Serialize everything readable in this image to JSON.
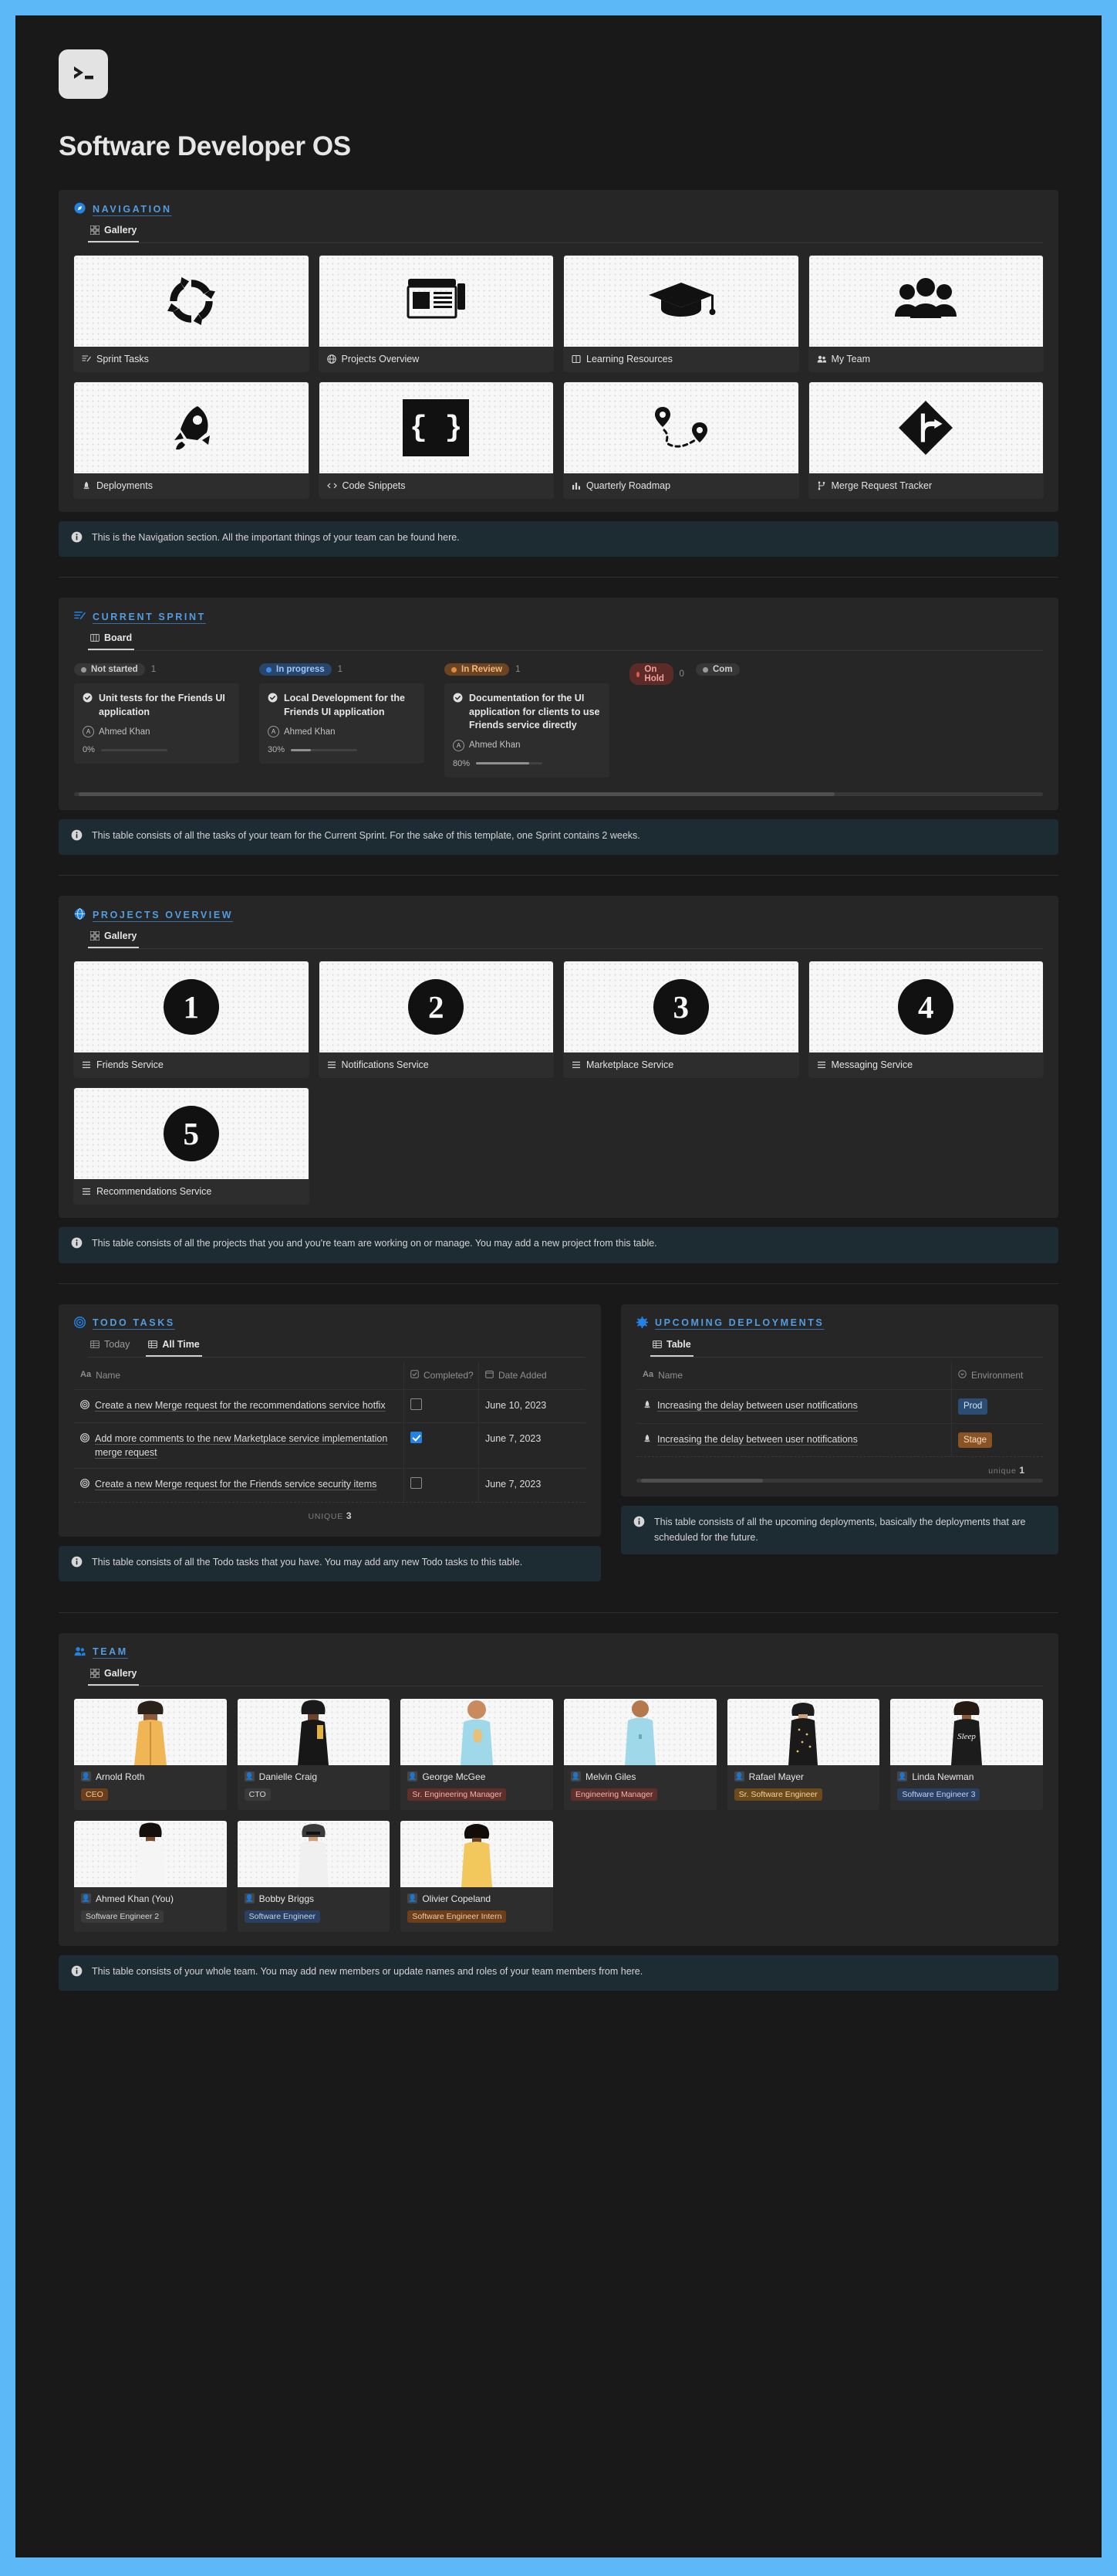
{
  "app": {
    "icon": "terminal-icon",
    "title": "Software Developer OS"
  },
  "navigation": {
    "section_label": "NAVIGATION",
    "section_icon": "compass-icon",
    "tabs": [
      {
        "label": "Gallery",
        "icon": "gallery-icon",
        "active": true
      }
    ],
    "cards": [
      {
        "label": "Sprint Tasks",
        "icon": "task-list-icon",
        "art": "refresh-cycle"
      },
      {
        "label": "Projects Overview",
        "icon": "globe-icon",
        "art": "browser-window"
      },
      {
        "label": "Learning Resources",
        "icon": "book-icon",
        "art": "graduation-cap"
      },
      {
        "label": "My Team",
        "icon": "people-icon",
        "art": "group-people"
      },
      {
        "label": "Deployments",
        "icon": "rocket-icon",
        "art": "rocket"
      },
      {
        "label": "Code Snippets",
        "icon": "code-icon",
        "art": "curly-braces"
      },
      {
        "label": "Quarterly Roadmap",
        "icon": "chart-icon",
        "art": "roadmap-pins"
      },
      {
        "label": "Merge Request Tracker",
        "icon": "branch-icon",
        "art": "merge-sign"
      }
    ],
    "callout": "This is the Navigation section. All the important things of your team can be found here.",
    "callout_icon": "info-icon"
  },
  "current_sprint": {
    "section_label": "CURRENT SPRINT",
    "section_icon": "task-list-icon",
    "tabs": [
      {
        "label": "Board",
        "icon": "board-icon",
        "active": true
      }
    ],
    "columns": [
      {
        "status": "Not started",
        "count": "1",
        "style": "p-grey",
        "cards": [
          {
            "title": "Unit tests for the Friends UI application",
            "assignee": "Ahmed Khan",
            "avatar": "A",
            "progress_label": "0%",
            "progress": 0
          }
        ]
      },
      {
        "status": "In progress",
        "count": "1",
        "style": "p-blue",
        "cards": [
          {
            "title": "Local Development for the Friends UI application",
            "assignee": "Ahmed Khan",
            "avatar": "A",
            "progress_label": "30%",
            "progress": 30
          }
        ]
      },
      {
        "status": "In Review",
        "count": "1",
        "style": "p-orng",
        "cards": [
          {
            "title": "Documentation for the UI application for clients to use Friends service directly",
            "assignee": "Ahmed Khan",
            "avatar": "A",
            "progress_label": "80%",
            "progress": 80
          }
        ]
      },
      {
        "status": "On Hold",
        "count": "0",
        "style": "p-red",
        "cards": []
      },
      {
        "status": "Com",
        "count": "",
        "style": "p-grey",
        "cards": []
      }
    ],
    "callout": "This table consists of all the tasks of your team for the Current Sprint. For the sake of this template, one Sprint contains 2 weeks.",
    "callout_icon": "info-icon"
  },
  "projects_overview": {
    "section_label": "PROJECTS OVERVIEW",
    "section_icon": "globe-icon",
    "tabs": [
      {
        "label": "Gallery",
        "icon": "gallery-icon",
        "active": true
      }
    ],
    "cards": [
      {
        "label": "Friends Service",
        "icon": "list-icon",
        "art": "1"
      },
      {
        "label": "Notifications Service",
        "icon": "list-icon",
        "art": "2"
      },
      {
        "label": "Marketplace Service",
        "icon": "list-icon",
        "art": "3"
      },
      {
        "label": "Messaging Service",
        "icon": "list-icon",
        "art": "4"
      },
      {
        "label": "Recommendations Service",
        "icon": "list-icon",
        "art": "5"
      }
    ],
    "callout": "This table consists of all the projects that you and you're team are working on or manage. You may add a new project from this table.",
    "callout_icon": "info-icon"
  },
  "todo_tasks": {
    "section_label": "TODO TASKS",
    "section_icon": "target-icon",
    "tabs": [
      {
        "label": "Today",
        "icon": "table-icon",
        "active": false
      },
      {
        "label": "All Time",
        "icon": "table-icon",
        "active": true
      }
    ],
    "headers": {
      "name": "Name",
      "completed": "Completed?",
      "date": "Date Added"
    },
    "header_icons": {
      "name": "text-icon",
      "completed": "checkbox-icon",
      "date": "calendar-icon"
    },
    "rows": [
      {
        "icon": "target-icon",
        "name": "Create a new Merge request for the recommendations service hotfix",
        "completed": false,
        "date": "June 10, 2023"
      },
      {
        "icon": "target-icon",
        "name": "Add more comments to the new Marketplace service implementation merge request",
        "completed": true,
        "date": "June 7, 2023"
      },
      {
        "icon": "target-icon",
        "name": "Create a new Merge request for the Friends service security items",
        "completed": false,
        "date": "June 7, 2023"
      }
    ],
    "unique_label": "UNIQUE",
    "unique_value": "3",
    "callout": "This table consists of all the Todo tasks that you have. You may add any new Todo tasks to this table.",
    "callout_icon": "info-icon"
  },
  "upcoming_deployments": {
    "section_label": "UPCOMING DEPLOYMENTS",
    "section_icon": "gear-icon",
    "tabs": [
      {
        "label": "Table",
        "icon": "table-icon",
        "active": true
      }
    ],
    "headers": {
      "name": "Name",
      "environment": "Environment"
    },
    "header_icons": {
      "name": "text-icon",
      "environment": "select-icon"
    },
    "rows": [
      {
        "icon": "rocket-icon",
        "name": "Increasing the delay between user notifications",
        "environment": "Prod",
        "env_style": "tag-prod"
      },
      {
        "icon": "rocket-icon",
        "name": "Increasing the delay between user notifications",
        "environment": "Stage",
        "env_style": "tag-stage"
      }
    ],
    "unique_label": "unique",
    "unique_value": "1",
    "callout": "This table consists of all the upcoming deployments, basically the deployments that are scheduled for the future.",
    "callout_icon": "info-icon"
  },
  "team": {
    "section_label": "TEAM",
    "section_icon": "people-icon",
    "tabs": [
      {
        "label": "Gallery",
        "icon": "gallery-icon",
        "active": true
      }
    ],
    "members": [
      {
        "name": "Arnold Roth",
        "role": "CEO",
        "role_style": "r-ceo",
        "avatar": "person-icon"
      },
      {
        "name": "Danielle Craig",
        "role": "CTO",
        "role_style": "r-cto",
        "avatar": "person-icon"
      },
      {
        "name": "George McGee",
        "role": "Sr. Engineering Manager",
        "role_style": "r-srem",
        "avatar": "person-icon"
      },
      {
        "name": "Melvin Giles",
        "role": "Engineering Manager",
        "role_style": "r-em",
        "avatar": "person-icon"
      },
      {
        "name": "Rafael Mayer",
        "role": "Sr. Software Engineer",
        "role_style": "r-srswe",
        "avatar": "person-icon"
      },
      {
        "name": "Linda Newman",
        "role": "Software Engineer 3",
        "role_style": "r-swe3",
        "avatar": "person-icon"
      },
      {
        "name": "Ahmed Khan (You)",
        "role": "Software Engineer 2",
        "role_style": "r-swe2",
        "avatar": "person-icon"
      },
      {
        "name": "Bobby Briggs",
        "role": "Software Engineer",
        "role_style": "r-swe",
        "avatar": "person-icon"
      },
      {
        "name": "Olivier Copeland",
        "role": "Software Engineer Intern",
        "role_style": "r-intern",
        "avatar": "person-icon"
      }
    ],
    "callout": "This table consists of your whole team. You may add new members or update names and roles of your team members from here.",
    "callout_icon": "info-icon"
  },
  "colors": {
    "page_bg": "#191919",
    "frame": "#5CB8F7",
    "card": "#262626",
    "accent": "#529CE0",
    "callout_bg": "#1d2b33"
  }
}
